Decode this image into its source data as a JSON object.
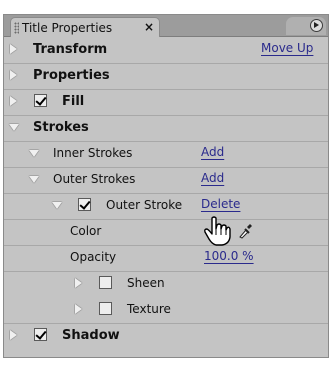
{
  "panel": {
    "tab_title": "Title Properties",
    "close_glyph": "×",
    "move_up": "Move Up"
  },
  "rows": {
    "transform": "Transform",
    "properties": "Properties",
    "fill": "Fill",
    "strokes": "Strokes",
    "inner_strokes": "Inner Strokes",
    "inner_add": "Add",
    "outer_strokes": "Outer Strokes",
    "outer_add": "Add",
    "outer_stroke": "Outer Stroke",
    "delete": "Delete",
    "color": "Color",
    "opacity": "Opacity",
    "opacity_value": "100.0 %",
    "sheen": "Sheen",
    "texture": "Texture",
    "shadow": "Shadow"
  },
  "state": {
    "fill_checked": true,
    "outer_stroke_checked": true,
    "sheen_checked": false,
    "texture_checked": false,
    "shadow_checked": true
  },
  "colors": {
    "panel_bg": "#c4c4c4",
    "link": "#2a2a8c",
    "color_swatch": "#ffffff"
  },
  "icons": [
    "grip-icon",
    "close-icon",
    "panel-menu-icon",
    "expand-triangle-icon",
    "collapse-triangle-icon",
    "eyedropper-icon",
    "hand-cursor-icon"
  ]
}
